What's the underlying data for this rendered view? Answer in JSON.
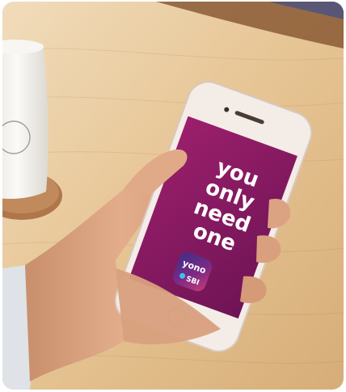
{
  "photo": {
    "screen_text": {
      "line1": "you",
      "line2": "only",
      "line3": "need",
      "line4": "one"
    },
    "app_logo": {
      "word": "yono",
      "brand": "SBI"
    },
    "colors": {
      "table_wood": "#e7c89a",
      "phone_screen": "#8b1a62",
      "phone_body": "#f4ece6",
      "mug": "#f3f2ee",
      "coaster": "#b0764a"
    }
  }
}
